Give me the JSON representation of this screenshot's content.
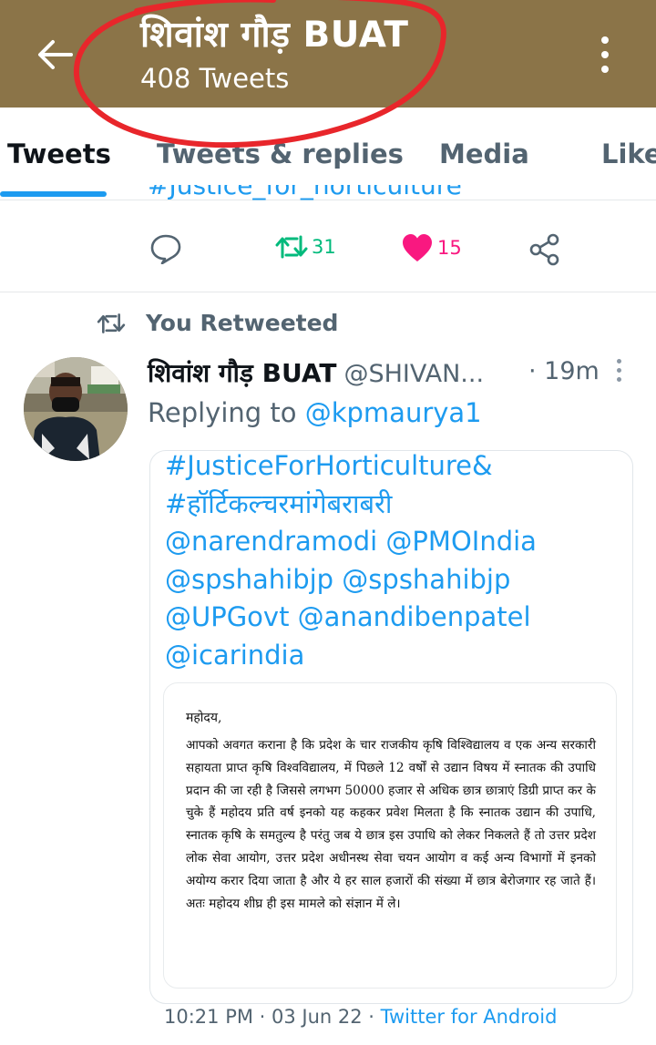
{
  "header": {
    "title": "शिवांश गौड़ BUAT",
    "subtitle": "408 Tweets",
    "background": "#8b7448"
  },
  "tabs": [
    {
      "label": "Tweets",
      "active": true
    },
    {
      "label": "Tweets & replies",
      "active": false
    },
    {
      "label": "Media",
      "active": false
    },
    {
      "label": "Like",
      "active": false
    }
  ],
  "prev_tweet": {
    "cut_text": "#Justice_for_horticulture",
    "retweets": "31",
    "likes": "15"
  },
  "tweet": {
    "retweeted_label": "You Retweeted",
    "author_name": "शिवांश गौड़ BUAT",
    "author_handle": "@SHIVAN...",
    "time": "· 19m",
    "replying_prefix": "Replying to",
    "replying_handle": "@kpmaurya1",
    "quote_lines": [
      "#JusticeForHorticulture&",
      "#हॉर्टिकल्चरमांगेबराबरी",
      "@narendramodi @PMOIndia",
      "@spshahibjp @spshahibjp",
      "@UPGovt @anandibenpatel",
      "@icarindia"
    ],
    "letter_greeting": "महोदय,",
    "letter_body": "आपको अवगत कराना है कि प्रदेश के चार राजकीय कृषि विश्विद्यालय व एक अन्य सरकारी सहायता प्राप्त कृषि विश्वविद्यालय, में पिछले 12 वर्षों से उद्यान विषय में स्नातक की उपाधि प्रदान की जा रही है जिससे लगभग 50000 हजार से अधिक छात्र छात्राएं डिग्री प्राप्त कर के चुके हैं महोदय प्रति वर्ष इनको यह कहकर प्रवेश मिलता है कि स्नातक उद्यान की उपाधि, स्नातक कृषि के समतुल्य है परंतु जब ये छात्र इस उपाधि को लेकर निकलते हैं तो उत्तर प्रदेश लोक सेवा आयोग, उत्तर प्रदेश अधीनस्थ सेवा चयन आयोग व कई अन्य विभागों में इनको अयोग्य करार दिया जाता है और ये हर साल हजारों की संख्या में छात्र बेरोजगार रह जाते हैं। अतः महोदय शीघ्र ही इस मामले को संज्ञान में ले।",
    "timestamp": "10:21 PM · 03 Jun 22 · ",
    "source": "Twitter for Android"
  },
  "colors": {
    "accent": "#1d9bf0",
    "retweet": "#00ba7c",
    "like": "#f91880",
    "annotation": "#e8262b"
  },
  "icons": [
    "back-arrow-icon",
    "more-vertical-icon",
    "reply-icon",
    "retweet-icon",
    "heart-icon",
    "share-icon",
    "kebab-icon"
  ]
}
